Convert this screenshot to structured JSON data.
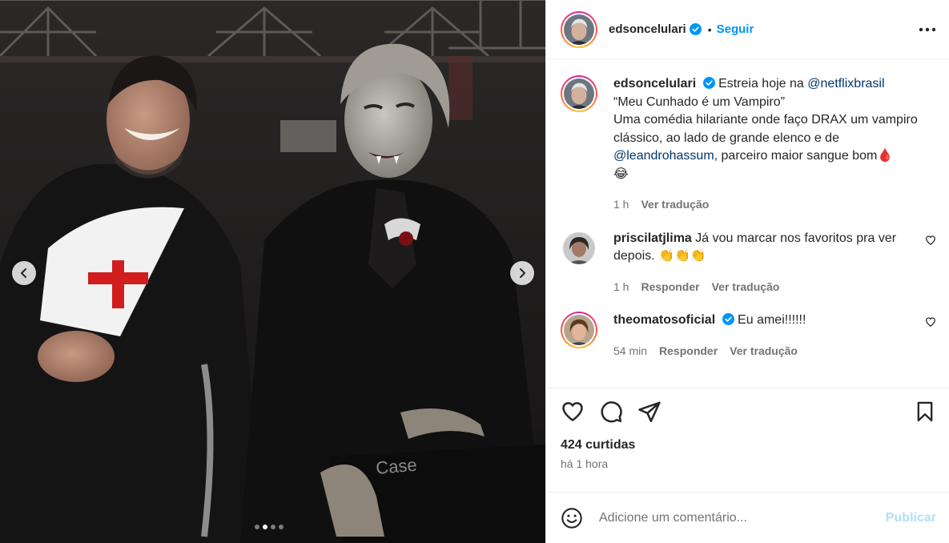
{
  "post": {
    "username": "edsoncelulari",
    "follow_label": "Seguir",
    "separator": "•"
  },
  "caption": {
    "username": "edsoncelulari",
    "text_1": "Estreia hoje na ",
    "mention_1": "@netflixbrasil",
    "text_2": "“Meu Cunhado é um Vampiro”",
    "text_3": "Uma comédia hilariante onde faço DRAX um vampiro clássico, ao lado de grande elenco e de ",
    "mention_2": "@leandrohassum",
    "text_4": ", parceiro maior sangue bom",
    "emoji_blood": "🩸",
    "emoji_laugh": "😂",
    "time": "1 h",
    "translate": "Ver tradução"
  },
  "comments": [
    {
      "username": "priscilatjlima",
      "text": "Já vou marcar nos favoritos pra ver depois. 👏👏👏",
      "time": "1 h",
      "reply": "Responder",
      "translate": "Ver tradução"
    },
    {
      "username": "theomatosoficial",
      "text": "Eu amei!!!!!!",
      "time": "54 min",
      "reply": "Responder",
      "translate": "Ver tradução"
    }
  ],
  "actions": {
    "likes": "424 curtidas",
    "time": "há 1 hora"
  },
  "add_comment": {
    "placeholder": "Adicione um comentário...",
    "publish": "Publicar"
  },
  "carousel": {
    "current": 2,
    "total": 4
  },
  "colors": {
    "accent": "#0095f6",
    "publish_disabled": "#b2dffc",
    "mention": "#00376b",
    "muted": "#737373"
  },
  "icons": [
    "verified-badge-icon",
    "more-options-icon",
    "heart-icon",
    "comment-icon",
    "share-icon",
    "bookmark-icon",
    "emoji-icon",
    "chevron-left-icon",
    "chevron-right-icon"
  ]
}
